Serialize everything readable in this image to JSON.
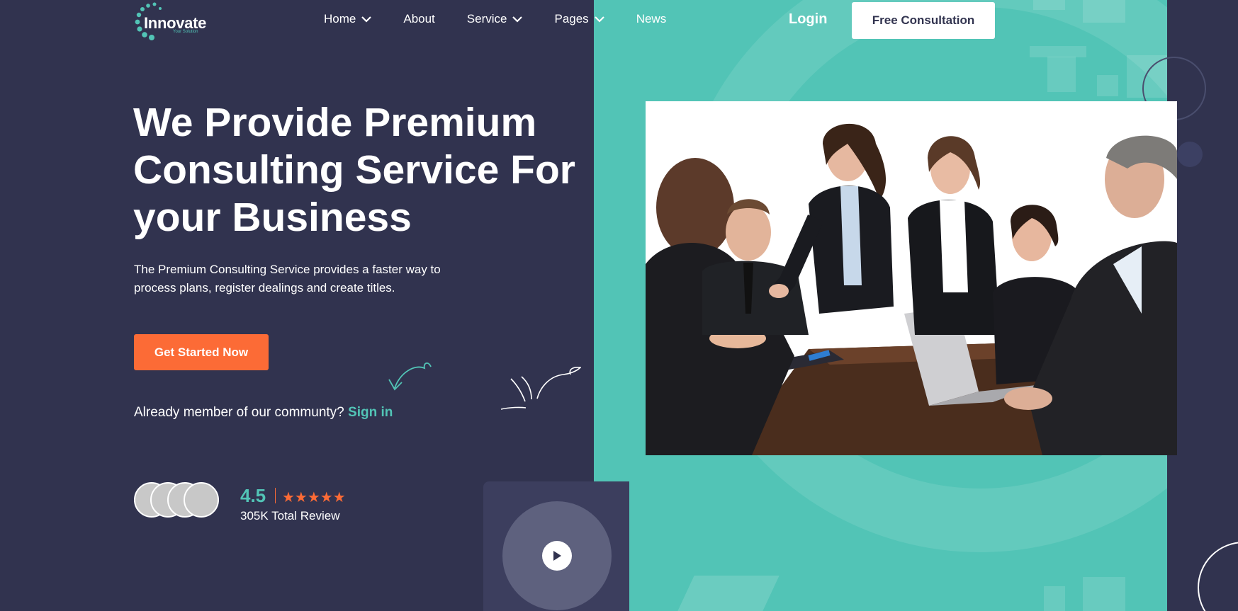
{
  "brand": {
    "name": "Innovate",
    "tagline": "Your Solution",
    "accent": "#52c4b6",
    "cta_color": "#fc6b36",
    "background": "#31334f"
  },
  "nav": {
    "items": [
      {
        "label": "Home",
        "has_dropdown": true
      },
      {
        "label": "About",
        "has_dropdown": false
      },
      {
        "label": "Service",
        "has_dropdown": true
      },
      {
        "label": "Pages",
        "has_dropdown": true
      },
      {
        "label": "News",
        "has_dropdown": false
      }
    ],
    "login_label": "Login",
    "consult_label": "Free Consultation"
  },
  "hero": {
    "title_lines": [
      "We Provide Premium",
      "Consulting Service For",
      "your Business"
    ],
    "subtitle_lines": [
      "The Premium Consulting Service provides a faster way to",
      "process plans, register dealings and create titles."
    ],
    "cta_label": "Get Started Now",
    "member_text": "Already member of our communty?",
    "signin_label": "Sign in"
  },
  "rating": {
    "value": "4.5",
    "stars": "★★★★★",
    "star_count": 5,
    "review_text": "305K Total Review"
  },
  "icons": {
    "chevron": "chevron-down-icon",
    "play": "play-icon",
    "star": "star-icon"
  }
}
